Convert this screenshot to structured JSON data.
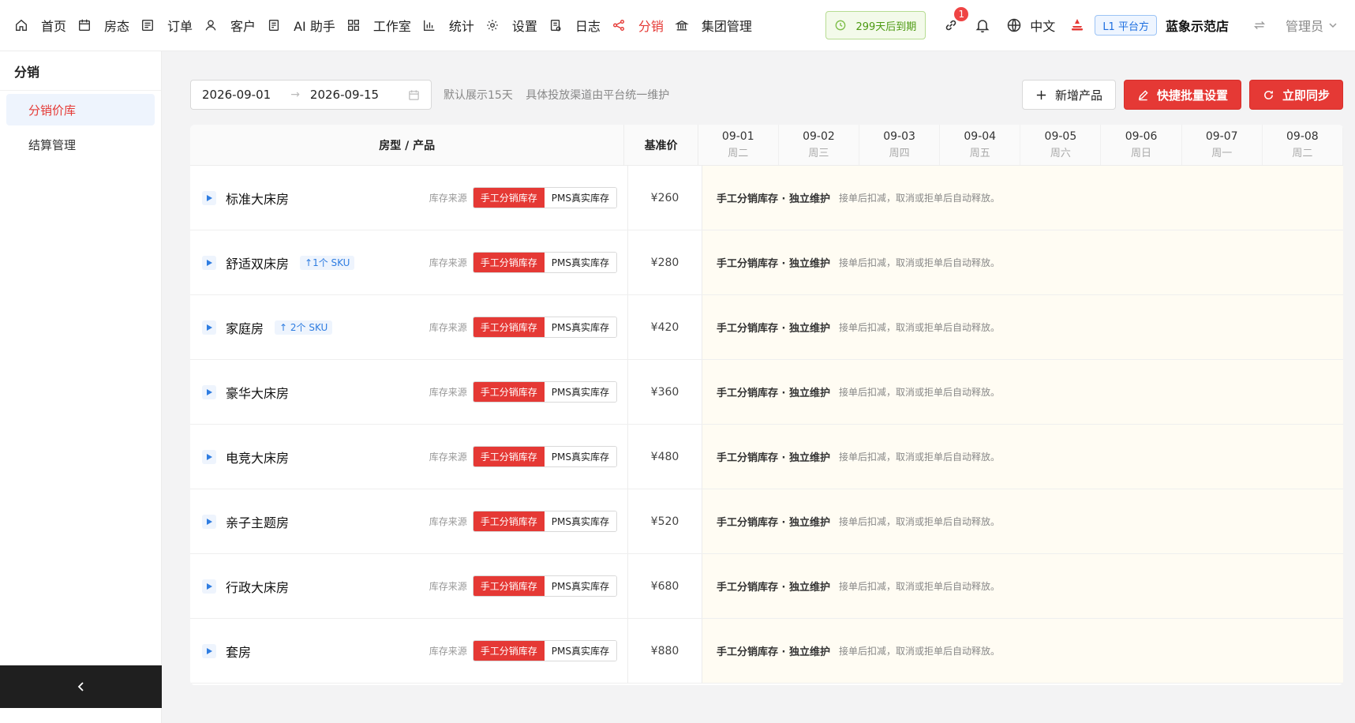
{
  "nav": {
    "items": [
      {
        "label": "首页",
        "icon": "home-icon"
      },
      {
        "label": "房态",
        "icon": "calendar-icon"
      },
      {
        "label": "订单",
        "icon": "order-icon"
      },
      {
        "label": "客户",
        "icon": "user-icon"
      },
      {
        "label": "AI 助手",
        "icon": "ai-assistant-icon"
      },
      {
        "label": "工作室",
        "icon": "grid-icon"
      },
      {
        "label": "统计",
        "icon": "bar-chart-icon"
      },
      {
        "label": "设置",
        "icon": "gear-icon"
      },
      {
        "label": "日志",
        "icon": "log-icon"
      },
      {
        "label": "分销",
        "icon": "share-icon"
      },
      {
        "label": "集团管理",
        "icon": "bank-icon"
      }
    ],
    "active": "分销"
  },
  "header": {
    "expiry": "299天后到期",
    "notify_count": "1",
    "language": "中文",
    "platform_tag": "L1 平台方",
    "store_name": "蓝象示范店",
    "user": "管理员"
  },
  "sidebar": {
    "title": "分销",
    "items": [
      {
        "label": "分销价库",
        "active": true
      },
      {
        "label": "结算管理",
        "active": false
      }
    ]
  },
  "toolbar": {
    "date_start": "2026-09-01",
    "date_end": "2026-09-15",
    "hint_1": "默认展示15天",
    "hint_2": "具体投放渠道由平台统一维护",
    "add_product": "新增产品",
    "batch_settings": "快捷批量设置",
    "sync_now": "立即同步"
  },
  "table": {
    "col_room": "房型 / 产品",
    "col_price": "基准价",
    "dates": [
      {
        "date": "09-01",
        "weekday": "周二"
      },
      {
        "date": "09-02",
        "weekday": "周三"
      },
      {
        "date": "09-03",
        "weekday": "周四"
      },
      {
        "date": "09-04",
        "weekday": "周五"
      },
      {
        "date": "09-05",
        "weekday": "周六"
      },
      {
        "date": "09-06",
        "weekday": "周日"
      },
      {
        "date": "09-07",
        "weekday": "周一"
      },
      {
        "date": "09-08",
        "weekday": "周二"
      }
    ],
    "source_label": "库存来源",
    "source_manual": "手工分销库存",
    "source_pms": "PMS真实库存",
    "info_title": "手工分销库存 · 独立维护",
    "info_desc": "接单后扣减，取消或拒单后自动释放。",
    "rows": [
      {
        "name": "标准大床房",
        "sku": "",
        "price": "¥260"
      },
      {
        "name": "舒适双床房",
        "sku": "↑1个 SKU",
        "price": "¥280"
      },
      {
        "name": "家庭房",
        "sku": "↑ 2个 SKU",
        "price": "¥420"
      },
      {
        "name": "豪华大床房",
        "sku": "",
        "price": "¥360"
      },
      {
        "name": "电竞大床房",
        "sku": "",
        "price": "¥480"
      },
      {
        "name": "亲子主题房",
        "sku": "",
        "price": "¥520"
      },
      {
        "name": "行政大床房",
        "sku": "",
        "price": "¥680"
      },
      {
        "name": "套房",
        "sku": "",
        "price": "¥880"
      }
    ]
  },
  "colors": {
    "accent": "#e53935",
    "link": "#2f7de1",
    "expiry_green": "#4d9a12",
    "info_bg": "#fffcf3"
  }
}
